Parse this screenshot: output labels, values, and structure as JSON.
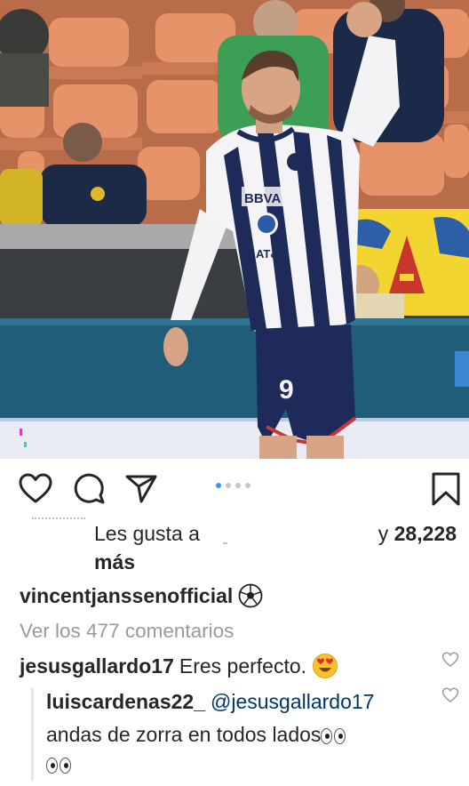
{
  "post": {
    "carousel": {
      "total": 4,
      "active_index": 0
    }
  },
  "likes": {
    "prefix": "Les gusta a",
    "connector": "y",
    "count": "28,228",
    "more": "más"
  },
  "caption": {
    "username": "vincentjanssenofficial",
    "emoji_icon": "soccer-ball-emoji"
  },
  "comments": {
    "view_all": "Ver los 477 comentarios",
    "items": [
      {
        "username": "jesusgallardo17",
        "text": "Eres perfecto.",
        "emoji_icon": "heart-eyes-emoji"
      }
    ],
    "reply": {
      "username": "luiscardenas22_",
      "mention": "@jesusgallardo17",
      "text": "andas de zorra en todos lados",
      "emoji_icon": "eyes-emoji"
    }
  },
  "colors": {
    "jersey_blue": "#1e2b5a",
    "jersey_white": "#f4f4f6",
    "seat_orange": "#e7936a",
    "carousel_active": "#3897f0",
    "link_blue": "#003569"
  }
}
